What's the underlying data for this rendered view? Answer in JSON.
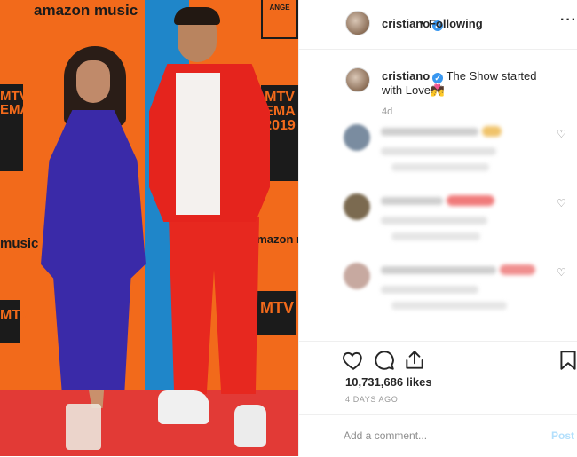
{
  "photo": {
    "brand_top": "amazon music",
    "brand_mid": "amazon m",
    "music_left": "music",
    "mtv_left": "MTV EMA",
    "mtv_right": "MTV EMA 2019",
    "mtv_small": "MTV",
    "logo_corner": "ANGE"
  },
  "header": {
    "username": "cristiano",
    "verified_icon": "verified-badge",
    "separator": "•",
    "follow_status": "Following",
    "more": "···"
  },
  "caption": {
    "username": "cristiano",
    "text": "The Show started with Love💏",
    "time": "4d"
  },
  "actions": {
    "likes": "10,731,686 likes",
    "posted_ago": "4 DAYS AGO",
    "comment_placeholder": "Add a comment...",
    "post_label": "Post"
  },
  "colors": {
    "accent": "#3897f0",
    "post_disabled": "#b2dffc"
  }
}
